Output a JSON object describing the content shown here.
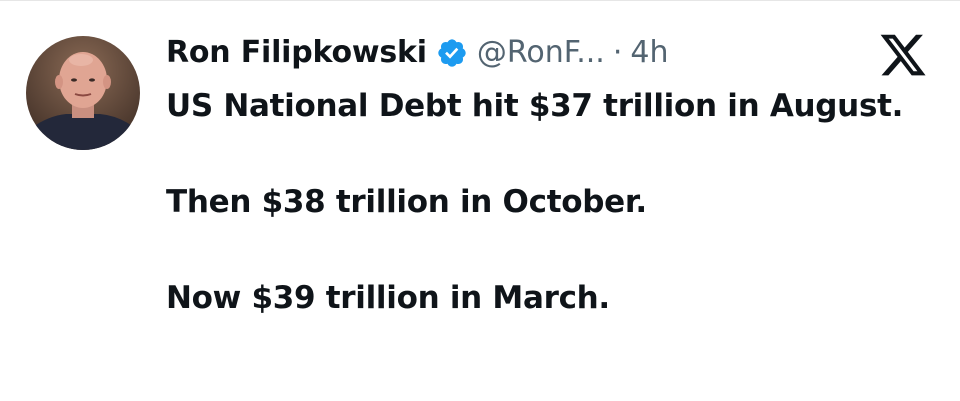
{
  "tweet": {
    "display_name": "Ron Filipkowski",
    "handle": "@RonF...",
    "separator": "·",
    "timestamp": "4h",
    "paragraphs": [
      "US National Debt hit $37 trillion in August.",
      "Then $38 trillion in October.",
      "Now $39 trillion in March."
    ]
  },
  "icons": {
    "avatar": "profile-photo",
    "verified": "verified-badge-icon",
    "platform": "x-logo-icon"
  },
  "colors": {
    "text": "#0f1419",
    "secondary_text": "#536471",
    "verified_blue": "#1d9bf0"
  }
}
